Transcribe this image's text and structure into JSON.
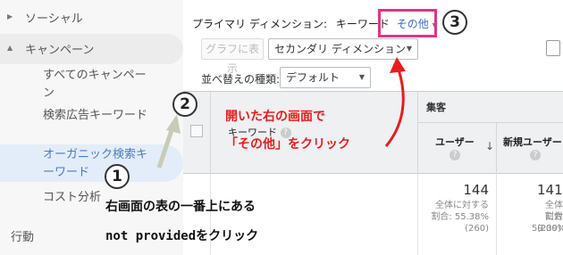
{
  "sidebar": {
    "social": "ソーシャル",
    "campaign": "キャンペーン",
    "items": [
      {
        "label": "すべてのキャンペーン"
      },
      {
        "label": "検索広告キーワード"
      },
      {
        "label": "オーガニック検索キーワード"
      },
      {
        "label": "コスト分析"
      }
    ],
    "behavior": "行動"
  },
  "dimension_bar": {
    "primary_label": "プライマリ ディメンション:",
    "keyword": "キーワード",
    "other": "その他"
  },
  "toolbar": {
    "graph_button": "グラフに表示",
    "secondary_dimension": "セカンダリ ディメンション",
    "sort_label": "並べ替えの種類:",
    "sort_value": "デフォルト"
  },
  "table": {
    "keyword_header": "キーワード",
    "acquisition_header": "集客",
    "users_header": "ユーザー",
    "new_users_header": "新規ユーザー",
    "help_glyph": "?",
    "row": {
      "users_value": "144",
      "users_sub1": "全体に対する",
      "users_sub2": "割合: 55.38%",
      "users_sub3": "(260)",
      "new_value": "141",
      "new_sub1": "全体に対",
      "new_sub2": "割合: 59.00%",
      "new_sub3": "(239)"
    }
  },
  "annotations": {
    "badge1": "1",
    "badge2": "2",
    "badge3": "3",
    "note_red_1": "開いた右の画面で",
    "note_red_2": "「その他」をクリック",
    "note_black_1": "右画面の表の一番上にある",
    "note_black_2": "not providedをクリック"
  },
  "colors": {
    "accent_blue": "#3b6fc9",
    "highlight_pink": "#e0338a",
    "note_red": "#e41e1e"
  }
}
